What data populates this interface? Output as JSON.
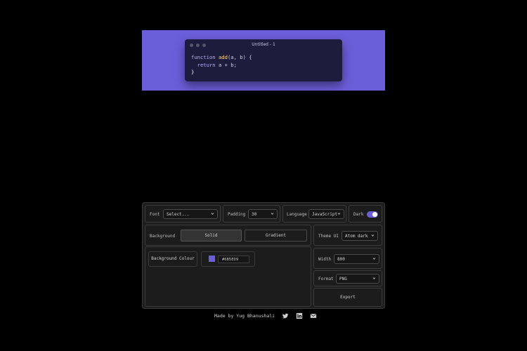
{
  "preview": {
    "background": "#6B5ED9",
    "window_title": "Untitled - 1",
    "code": {
      "line1_kw": "function",
      "line1_fn": "add",
      "line1_rest": "(a, b) {",
      "line2_kw": "return",
      "line2_rest": " a + b;",
      "line3": "}"
    }
  },
  "settings": {
    "font": {
      "label": "Font",
      "value": "Select..."
    },
    "padding": {
      "label": "Padding",
      "value": "30"
    },
    "language": {
      "label": "Language",
      "value": "JavaScript"
    },
    "dark": {
      "label": "Dark",
      "enabled": true
    },
    "background": {
      "label": "Background",
      "options": [
        "Solid",
        "Gradient"
      ],
      "selected": "Solid"
    },
    "theme_ui": {
      "label": "Theme UI",
      "value": "Atom dark"
    },
    "background_colour": {
      "label": "Background Colour",
      "hex": "#6B5ED9"
    },
    "width": {
      "label": "Width",
      "value": "800"
    },
    "format": {
      "label": "Format",
      "value": "PNG"
    },
    "export_label": "Export"
  },
  "footer": {
    "text": "Made by Yug Bhanushali",
    "icons": [
      "twitter-icon",
      "linkedin-icon",
      "mail-icon"
    ]
  },
  "colors": {
    "accent": "#6B5ED9",
    "panel_bg": "#1E1E1E",
    "code_bg": "#1E1C3D"
  }
}
